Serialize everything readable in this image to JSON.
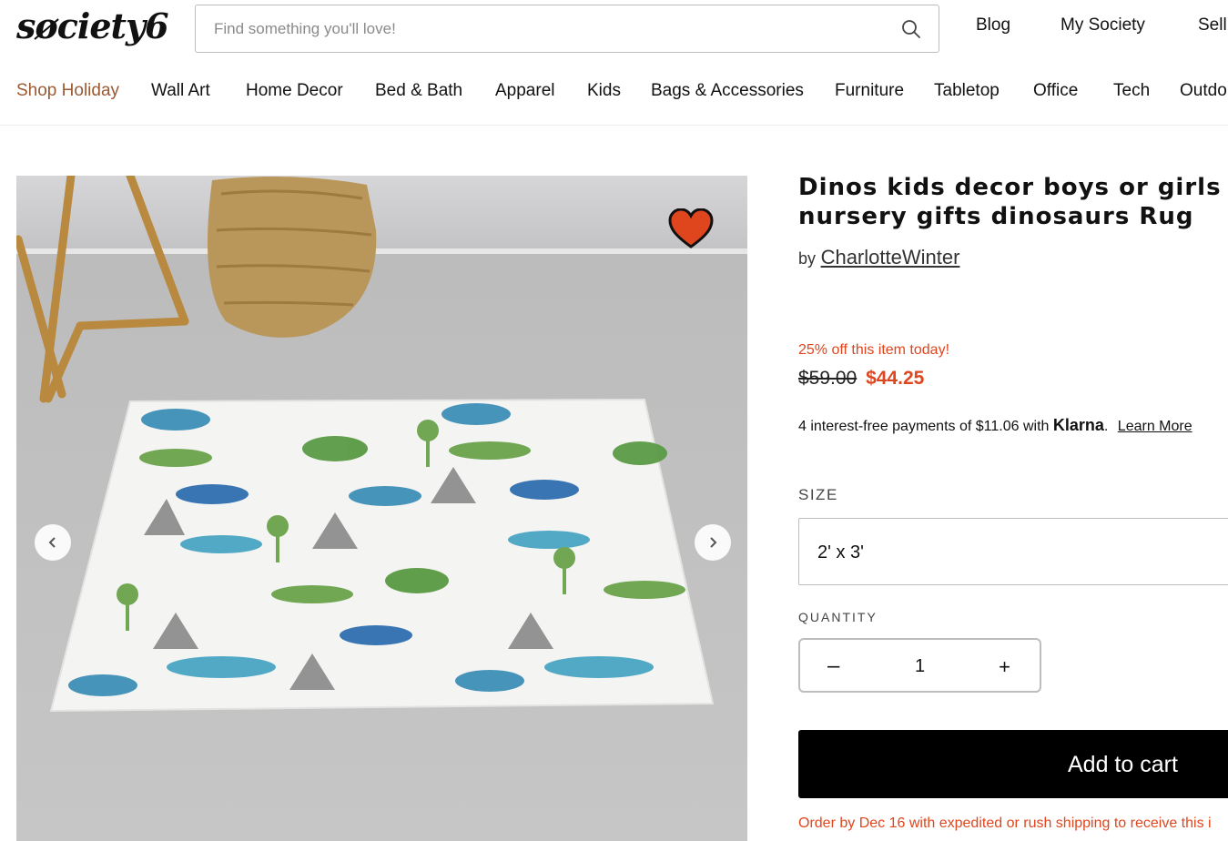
{
  "header": {
    "logo": "søciety6",
    "search_placeholder": "Find something you'll love!",
    "links": [
      "Blog",
      "My Society",
      "Sell"
    ]
  },
  "nav": {
    "items": [
      "Shop Holiday",
      "Wall Art",
      "Home Decor",
      "Bed & Bath",
      "Apparel",
      "Kids",
      "Bags & Accessories",
      "Furniture",
      "Tabletop",
      "Office",
      "Tech",
      "Outdo"
    ]
  },
  "product": {
    "title_line1": "Dinos kids decor boys or girls roon",
    "title_line2": "nursery gifts dinosaurs Rug",
    "by_label": "by",
    "artist": "CharlotteWinter",
    "promo": "25% off this item today!",
    "old_price": "$59.00",
    "new_price": "$44.25",
    "klarna_text": "4 interest-free payments of $11.06 with",
    "klarna_brand": "Klarna",
    "klarna_dot": ".",
    "learn_more": "Learn More",
    "size_label": "SIZE",
    "size_value": "2' x 3'",
    "quantity_label": "QUANTITY",
    "quantity_minus": "–",
    "quantity_value": "1",
    "quantity_plus": "+",
    "add_to_cart": "Add to cart",
    "ship_note": "Order by Dec 16 with expedited or rush shipping to receive this i"
  },
  "colors": {
    "accent_red": "#e0461e",
    "holiday_brown": "#9a5a33",
    "heart": "#e0461e"
  },
  "icons": [
    "search-icon",
    "heart-icon",
    "chevron-left-icon",
    "chevron-right-icon"
  ]
}
